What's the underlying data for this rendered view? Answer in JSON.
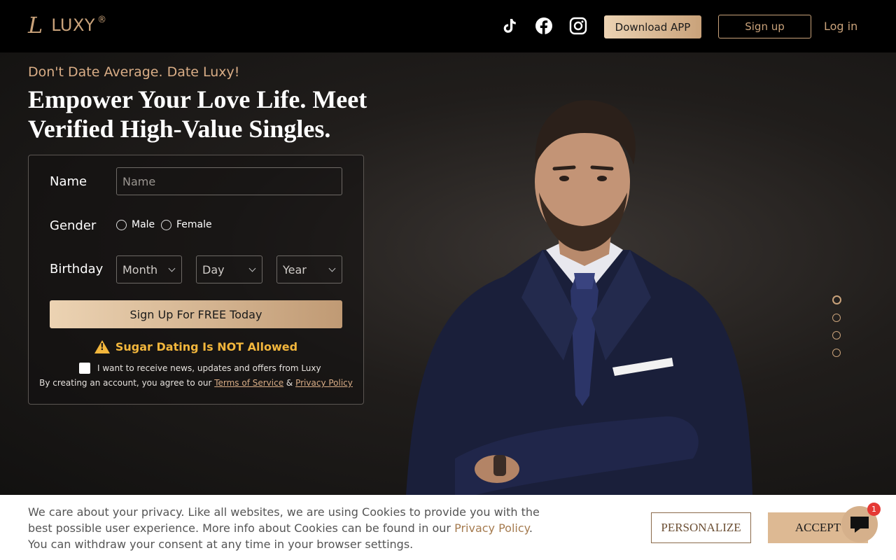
{
  "brand": {
    "name": "LUXY",
    "mark": "L",
    "reg": "®"
  },
  "header": {
    "social": [
      "tiktok-icon",
      "facebook-icon",
      "instagram-icon"
    ],
    "download_label": "Download APP",
    "signup_label": "Sign up",
    "login_label": "Log in"
  },
  "hero": {
    "tagline": "Don't Date Average. Date Luxy!",
    "headline": "Empower Your Love Life. Meet Verified High-Value Singles."
  },
  "form": {
    "name_label": "Name",
    "name_placeholder": "Name",
    "gender_label": "Gender",
    "gender_options": [
      "Male",
      "Female"
    ],
    "birthday_label": "Birthday",
    "month": "Month",
    "day": "Day",
    "year": "Year",
    "cta_label": "Sign Up For FREE Today",
    "warning": "Sugar Dating Is NOT Allowed",
    "newsletter": "I want to receive news, updates and offers from Luxy",
    "terms_prefix": "By creating an account, you agree to our ",
    "terms_link": "Terms of Service",
    "terms_amp": " & ",
    "privacy_link": "Privacy Policy"
  },
  "carousel": {
    "count": 4,
    "active": 0
  },
  "cookie": {
    "line1": "We care about your privacy. Like all websites, we are using Cookies to provide you with the best possible user experience. More info about Cookies can be found in our ",
    "privacy_link": "Privacy Policy",
    "line1_end": ".",
    "line2": "You can withdraw your consent at any time in your browser settings.",
    "personalize_label": "PERSONALIZE",
    "accept_label": "ACCEPT"
  },
  "chat": {
    "badge": "1"
  },
  "colors": {
    "gold": "#c9a27a",
    "warning": "#f2b63c",
    "badge": "#e53935"
  }
}
